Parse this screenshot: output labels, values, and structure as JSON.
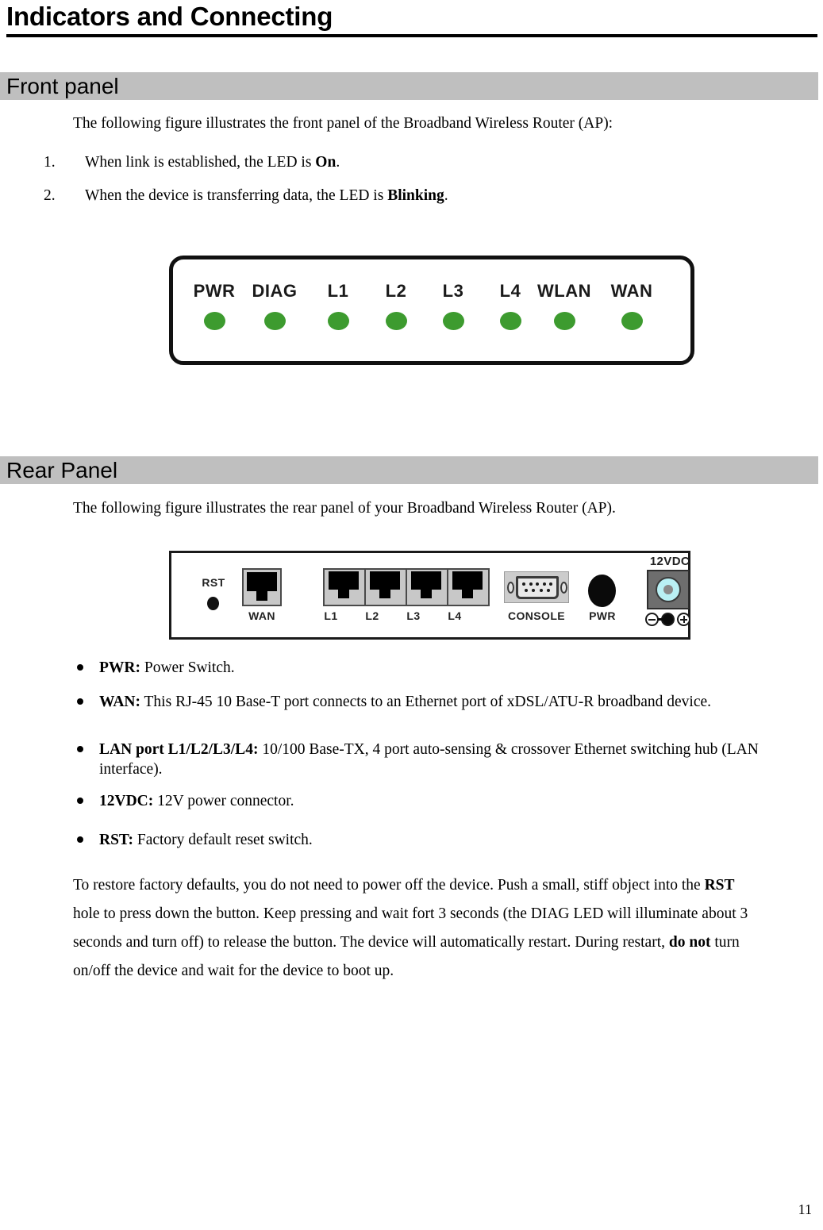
{
  "document": {
    "title": "Indicators and Connecting",
    "page_number": "11"
  },
  "sections": {
    "front": {
      "heading": "Front panel",
      "intro": "The following figure illustrates the front panel of the Broadband Wireless Router (AP):",
      "numbered_items": [
        {
          "number": "1.",
          "text_before": "When link is established, the LED is ",
          "bold": "On",
          "text_after": "."
        },
        {
          "number": "2.",
          "text_before": "When the device is transferring data, the LED is ",
          "bold": "Blinking",
          "text_after": "."
        }
      ],
      "figure": {
        "name": "front-panel-diagram",
        "leds": [
          "PWR",
          "DIAG",
          "L1",
          "L2",
          "L3",
          "L4",
          "WLAN",
          "WAN"
        ],
        "led_color": "#3d9b2f"
      }
    },
    "rear": {
      "heading": "Rear Panel",
      "intro": "The following figure illustrates the rear panel of your Broadband Wireless Router (AP).",
      "figure": {
        "name": "rear-panel-diagram",
        "rst_label": "RST",
        "wan_label": "WAN",
        "lan_labels": [
          "L1",
          "L2",
          "L3",
          "L4"
        ],
        "console_label": "CONSOLE",
        "pwr_label": "PWR",
        "vdc_label": "12VDC"
      },
      "bullets": [
        {
          "term": "PWR:",
          "desc": " Power Switch."
        },
        {
          "term": "WAN:",
          "desc": " This RJ-45 10 Base-T port connects to an Ethernet port of xDSL/ATU-R broadband device."
        },
        {
          "term": "LAN port L1/L2/L3/L4:",
          "desc": " 10/100 Base-TX, 4 port auto-sensing & crossover Ethernet switching hub (LAN interface)."
        },
        {
          "term": "12VDC:",
          "desc": " 12V power connector."
        },
        {
          "term": "RST:",
          "desc": " Factory default reset switch."
        }
      ],
      "closing_paragraph": {
        "p1": "To restore factory defaults, you do not need to power off the device. Push a small, stiff object into the ",
        "b1": "RST",
        "p2": " hole to press down the button. Keep pressing and wait fort 3 seconds (the DIAG LED will illuminate about 3 seconds and turn off) to release the button. The device will automatically restart. During restart, ",
        "b2": "do not",
        "p3": " turn on/off the device and wait for the device to boot up."
      }
    }
  },
  "colors": {
    "section_bar": "#bfbfbf",
    "led_green": "#3d9b2f",
    "rule": "#000000"
  }
}
